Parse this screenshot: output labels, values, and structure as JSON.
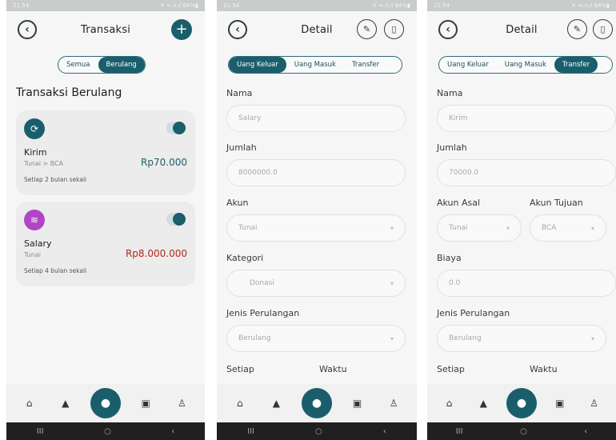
{
  "status": {
    "time": "21:54",
    "signal": "✕ ≈.ıl.ıl 64%▮"
  },
  "screen1": {
    "title": "Transaksi",
    "tabs": [
      "Semua",
      "Berulang"
    ],
    "section_title": "Transaksi Berulang",
    "cards": [
      {
        "name": "Kirim",
        "sub": "Tunai > BCA",
        "amount": "Rp70.000",
        "freq": "Setiap 2 bulan sekali",
        "amount_color": "#1b5e6b",
        "icon_color": "#1b5e6b"
      },
      {
        "name": "Salary",
        "sub": "Tunai",
        "amount": "Rp8.000.000",
        "freq": "Setiap 4 bulan sekali",
        "amount_color": "#b3261e",
        "icon_color": "#b046c7"
      }
    ]
  },
  "screen2": {
    "title": "Detail",
    "tabs": [
      "Uang Keluar",
      "Uang Masuk",
      "Transfer"
    ],
    "fields": {
      "nama_label": "Nama",
      "nama_value": "Salary",
      "jumlah_label": "Jumlah",
      "jumlah_value": "8000000.0",
      "akun_label": "Akun",
      "akun_value": "Tunai",
      "kategori_label": "Kategori",
      "kategori_value": "Donasi",
      "jenis_label": "Jenis Perulangan",
      "jenis_value": "Berulang",
      "setiap_label": "Setiap",
      "waktu_label": "Waktu"
    }
  },
  "screen3": {
    "title": "Detail",
    "tabs": [
      "Uang Keluar",
      "Uang Masuk",
      "Transfer"
    ],
    "fields": {
      "nama_label": "Nama",
      "nama_value": "Kirim",
      "jumlah_label": "Jumlah",
      "jumlah_value": "70000.0",
      "akun_asal_label": "Akun Asal",
      "akun_asal_value": "Tunai",
      "akun_tujuan_label": "Akun Tujuan",
      "akun_tujuan_value": "BCA",
      "biaya_label": "Biaya",
      "biaya_value": "0.0",
      "jenis_label": "Jenis Perulangan",
      "jenis_value": "Berulang",
      "setiap_label": "Setiap",
      "waktu_label": "Waktu"
    }
  },
  "nav": {
    "items": [
      "home-icon",
      "chart-icon",
      "mic-icon",
      "wallet-icon",
      "user-icon"
    ]
  },
  "sysnav": {
    "recent": "III",
    "home": "○",
    "back": "‹"
  }
}
